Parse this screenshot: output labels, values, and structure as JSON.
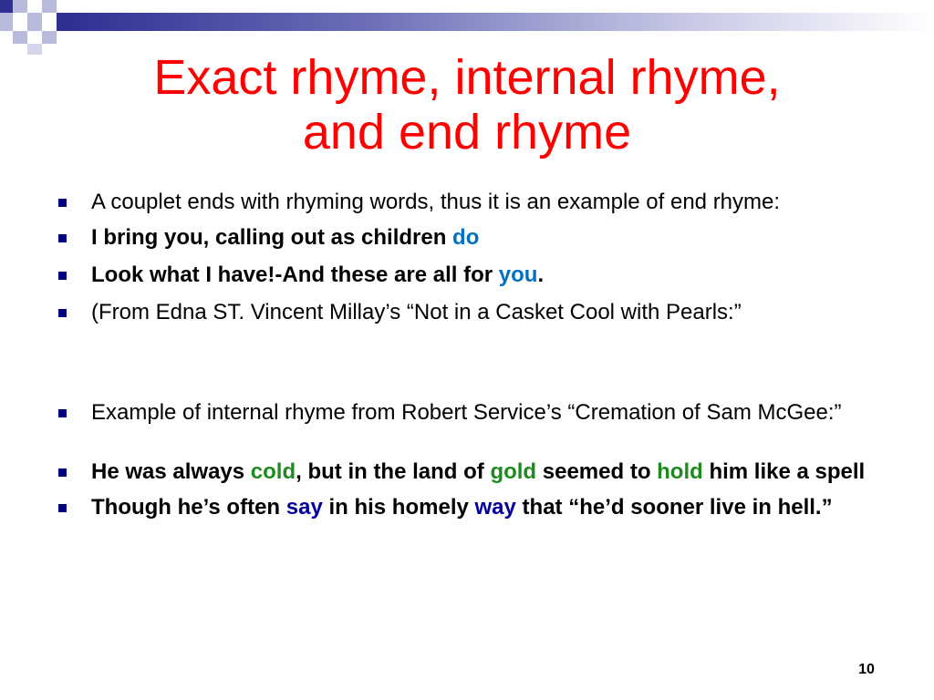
{
  "colors": {
    "title": "#ff0000",
    "bullet_marker": "#000080",
    "rhyme_blue": "#0070c0",
    "rhyme_green": "#1f8a1f",
    "rhyme_navy": "#0000a0",
    "header_bar": "#2e3192"
  },
  "slide": {
    "title_line1": "Exact rhyme, internal rhyme,",
    "title_line2": "and end rhyme",
    "page_number": "10"
  },
  "bullets": {
    "b1": "A couplet ends with rhyming words, thus it is an example of end rhyme:",
    "b2_pre": "I bring you, calling out as children ",
    "b2_rhyme": "do",
    "b3_pre": "Look what I have!-And these are all for ",
    "b3_rhyme": "you",
    "b3_post": ".",
    "b4": "(From Edna ST. Vincent Millay’s “Not in a Casket Cool with Pearls:”",
    "b5": "Example of internal rhyme from Robert Service’s “Cremation of Sam McGee:”",
    "b6_part1": "He was always ",
    "b6_rhyme1": "cold",
    "b6_part2": ", but in the land of ",
    "b6_rhyme2": "gold",
    "b6_part3": " seemed to ",
    "b6_rhyme3": "hold",
    "b6_part4": " him like a spell",
    "b7_part1": "Though he’s often ",
    "b7_rhyme1": "say",
    "b7_part2": " in his homely ",
    "b7_rhyme2": "way",
    "b7_part3": " that “he’d sooner live in hell.”"
  }
}
